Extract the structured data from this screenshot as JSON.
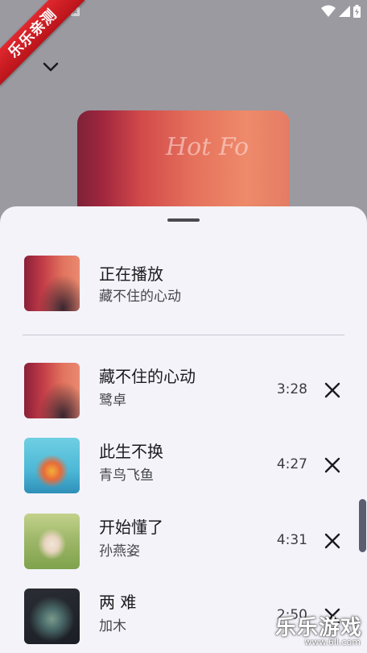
{
  "status_bar": {
    "notification_letter": "A",
    "icons": [
      "wifi-icon",
      "signal-icon",
      "battery-icon"
    ]
  },
  "watermark_ribbon": "乐乐亲测",
  "player": {
    "album_art_text": "Hot Fo"
  },
  "queue": {
    "now_playing": {
      "label": "正在播放",
      "song": "藏不住的心动"
    },
    "items": [
      {
        "title": "藏不住的心动",
        "artist": "鹭卓",
        "duration": "3:28"
      },
      {
        "title": "此生不换",
        "artist": "青鸟飞鱼",
        "duration": "4:27"
      },
      {
        "title": "开始懂了",
        "artist": "孙燕姿",
        "duration": "4:31"
      },
      {
        "title": "两 难",
        "artist": "加木",
        "duration": "2:50"
      }
    ]
  },
  "watermark": {
    "text": "乐乐游戏",
    "url": "www.6ll.com"
  },
  "colors": {
    "sheet_background": "#f4f3fa",
    "scrim": "#9a9aa0",
    "scrollbar": "#5a5e6e"
  }
}
